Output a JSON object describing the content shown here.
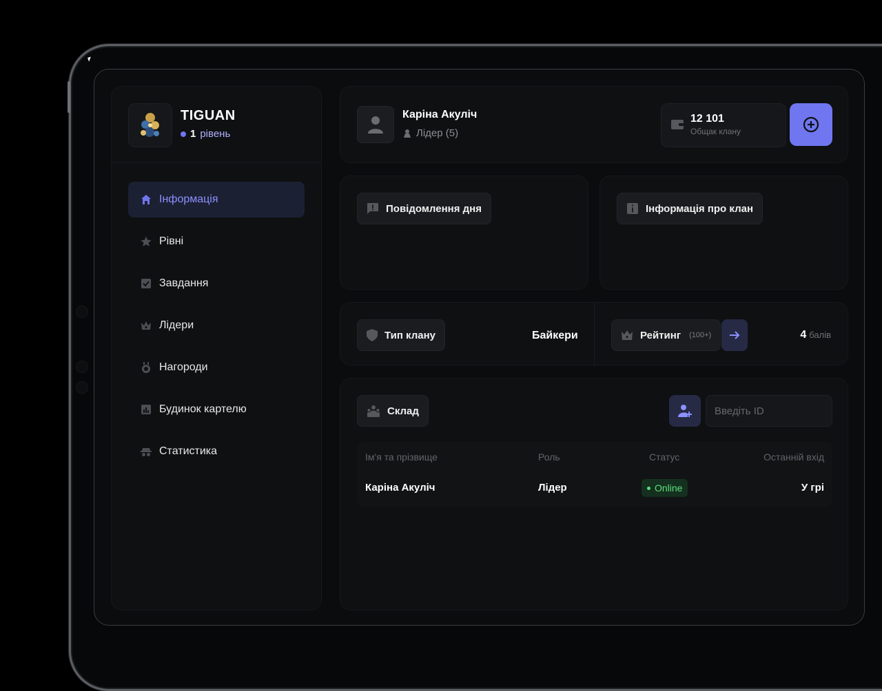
{
  "colors": {
    "accent": "#6f76ef",
    "online": "#5ae07c",
    "bg": "#0b0c0e"
  },
  "clan": {
    "name": "TIGUAN",
    "level_num": "1",
    "level_word": "рівень"
  },
  "nav": [
    {
      "label": "Інформація",
      "icon": "home-icon",
      "active": true
    },
    {
      "label": "Рівні",
      "icon": "star-icon"
    },
    {
      "label": "Завдання",
      "icon": "checkbox-icon"
    },
    {
      "label": "Лідери",
      "icon": "crown-icon"
    },
    {
      "label": "Нагороди",
      "icon": "medal-icon"
    },
    {
      "label": "Будинок картелю",
      "icon": "chart-icon"
    },
    {
      "label": "Статистика",
      "icon": "spy-icon"
    }
  ],
  "user": {
    "name": "Каріна Акуліч",
    "role": "Лідер (5)"
  },
  "bank": {
    "value": "12 101",
    "label": "Общак клану"
  },
  "message_of_day": {
    "label": "Повідомлення дня"
  },
  "clan_info": {
    "label": "Інформація про клан"
  },
  "clan_type": {
    "label": "Тип клану",
    "value": "Байкери"
  },
  "rating": {
    "label": "Рейтинг",
    "note": "(100+)",
    "points": "4",
    "points_unit": "балів"
  },
  "roster": {
    "label": "Склад",
    "search_placeholder": "Введіть ID",
    "columns": [
      "Ім'я та прізвище",
      "Роль",
      "Статус",
      "Останній вхід"
    ],
    "rows": [
      {
        "name": "Каріна Акуліч",
        "role": "Лідер",
        "status": "Online",
        "last_login": "У грі"
      }
    ]
  }
}
